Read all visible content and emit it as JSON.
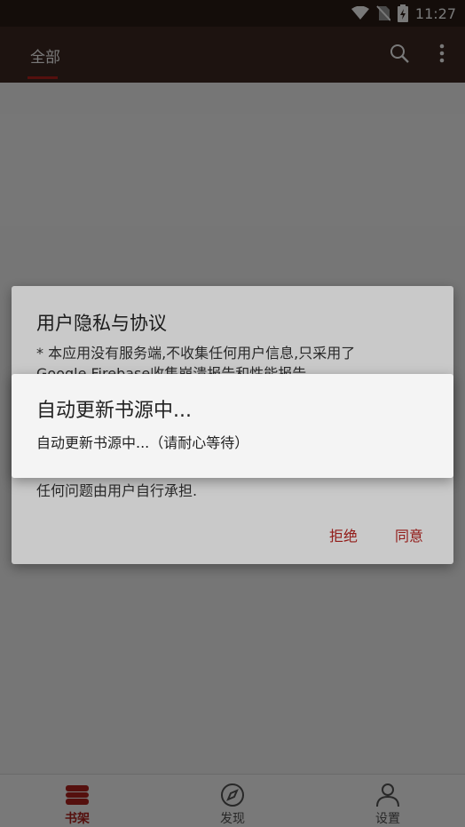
{
  "status_bar": {
    "time": "11:27"
  },
  "toolbar": {
    "tab_all": "全部",
    "search_icon": "search-icon",
    "more_icon": "more-vert-icon"
  },
  "bottom_nav": {
    "items": [
      {
        "label": "书架",
        "icon": "bookshelf-icon",
        "active": true
      },
      {
        "label": "发现",
        "icon": "compass-icon",
        "active": false
      },
      {
        "label": "设置",
        "icon": "person-icon",
        "active": false
      }
    ]
  },
  "privacy_dialog": {
    "title": "用户隐私与协议",
    "body_line1": "* 本应用没有服务端,不收集任何用户信息,只采用了",
    "body_line2": "Google Firebase收集崩溃报告和性能报告.",
    "body_tail": "任何问题由用户自行承担.",
    "reject": "拒绝",
    "agree": "同意"
  },
  "progress_dialog": {
    "title": "自动更新书源中...",
    "message": "自动更新书源中...（请耐心等待）"
  },
  "colors": {
    "accent": "#b3231f",
    "toolbar": "#3e2a23",
    "status_bar": "#2b1c17"
  }
}
